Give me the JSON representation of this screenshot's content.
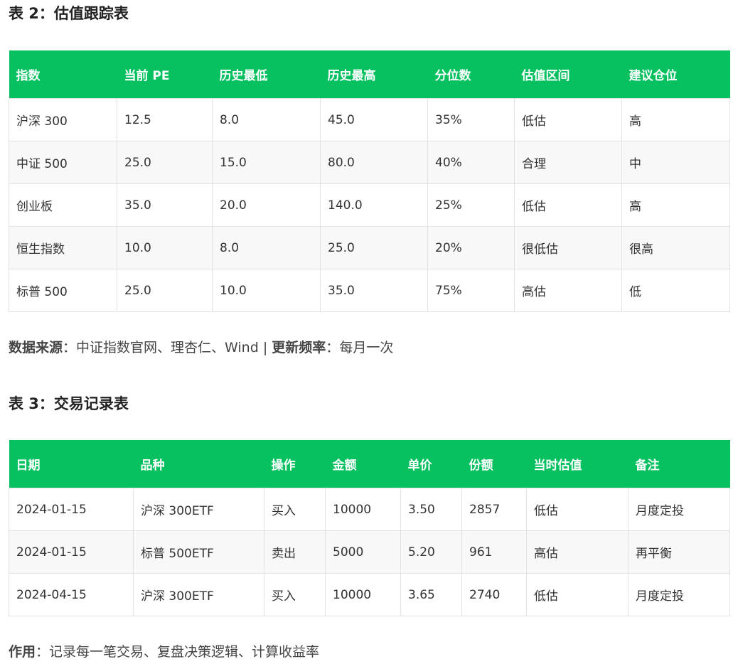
{
  "table2": {
    "title": "表 2：估值跟踪表",
    "headers": [
      "指数",
      "当前 PE",
      "历史最低",
      "历史最高",
      "分位数",
      "估值区间",
      "建议仓位"
    ],
    "rows": [
      [
        "沪深 300",
        "12.5",
        "8.0",
        "45.0",
        "35%",
        "低估",
        "高"
      ],
      [
        "中证 500",
        "25.0",
        "15.0",
        "80.0",
        "40%",
        "合理",
        "中"
      ],
      [
        "创业板",
        "35.0",
        "20.0",
        "140.0",
        "25%",
        "低估",
        "高"
      ],
      [
        "恒生指数",
        "10.0",
        "8.0",
        "25.0",
        "20%",
        "很低估",
        "很高"
      ],
      [
        "标普 500",
        "25.0",
        "10.0",
        "35.0",
        "75%",
        "高估",
        "低"
      ]
    ],
    "row_status": [
      "green",
      "neutral",
      "green",
      "green",
      "red"
    ]
  },
  "source_note": {
    "label1": "数据来源",
    "sep1": "：",
    "value1": "中证指数官网、理杏仁、Wind",
    "divider": " | ",
    "label2": "更新频率",
    "sep2": "：",
    "value2": "每月一次"
  },
  "table3": {
    "title": "表 3：交易记录表",
    "headers": [
      "日期",
      "品种",
      "操作",
      "金额",
      "单价",
      "份额",
      "当时估值",
      "备注"
    ],
    "rows": [
      [
        "2024-01-15",
        "沪深 300ETF",
        "买入",
        "10000",
        "3.50",
        "2857",
        "低估",
        "月度定投"
      ],
      [
        "2024-01-15",
        "标普 500ETF",
        "卖出",
        "5000",
        "5.20",
        "961",
        "高估",
        "再平衡"
      ],
      [
        "2024-04-15",
        "沪深 300ETF",
        "买入",
        "10000",
        "3.65",
        "2740",
        "低估",
        "月度定投"
      ]
    ],
    "row_status": [
      "green",
      "red",
      "green"
    ]
  },
  "purpose_note": {
    "label": "作用",
    "sep": "：",
    "value": "记录每一笔交易、复盘决策逻辑、计算收益率"
  },
  "colors": {
    "header_bg": "#07c160",
    "positive": "#07c160",
    "negative": "#d9534f",
    "text": "#333333"
  }
}
